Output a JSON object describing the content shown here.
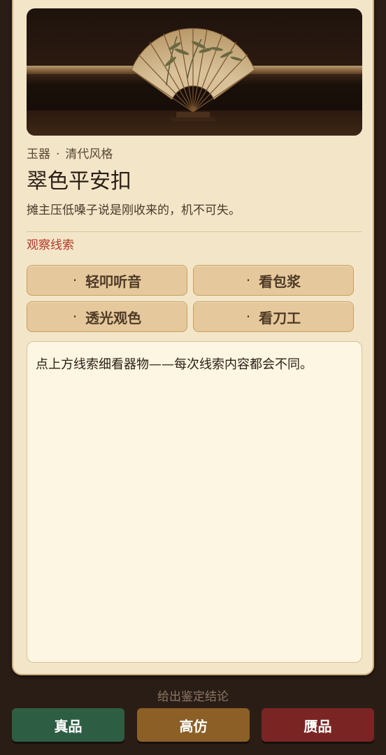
{
  "item": {
    "category": "玉器",
    "separator": "·",
    "style": "清代风格",
    "name": "翠色平安扣",
    "description": "摊主压低嗓子说是刚收来的，机不可失。"
  },
  "clues": {
    "title": "观察线索",
    "bullet": "·",
    "items": [
      {
        "label": "轻叩听音"
      },
      {
        "label": "看包浆"
      },
      {
        "label": "透光观色"
      },
      {
        "label": "看刀工"
      }
    ]
  },
  "notes": {
    "text": "点上方线索细看器物——每次线索内容都会不同。"
  },
  "verdict": {
    "label": "给出鉴定结论",
    "genuine": "真品",
    "replica": "高仿",
    "fake": "赝品"
  },
  "colors": {
    "genuine": "#2d5e43",
    "replica": "#8c5f27",
    "fake": "#7b2424",
    "clue_title": "#b23a2a"
  }
}
